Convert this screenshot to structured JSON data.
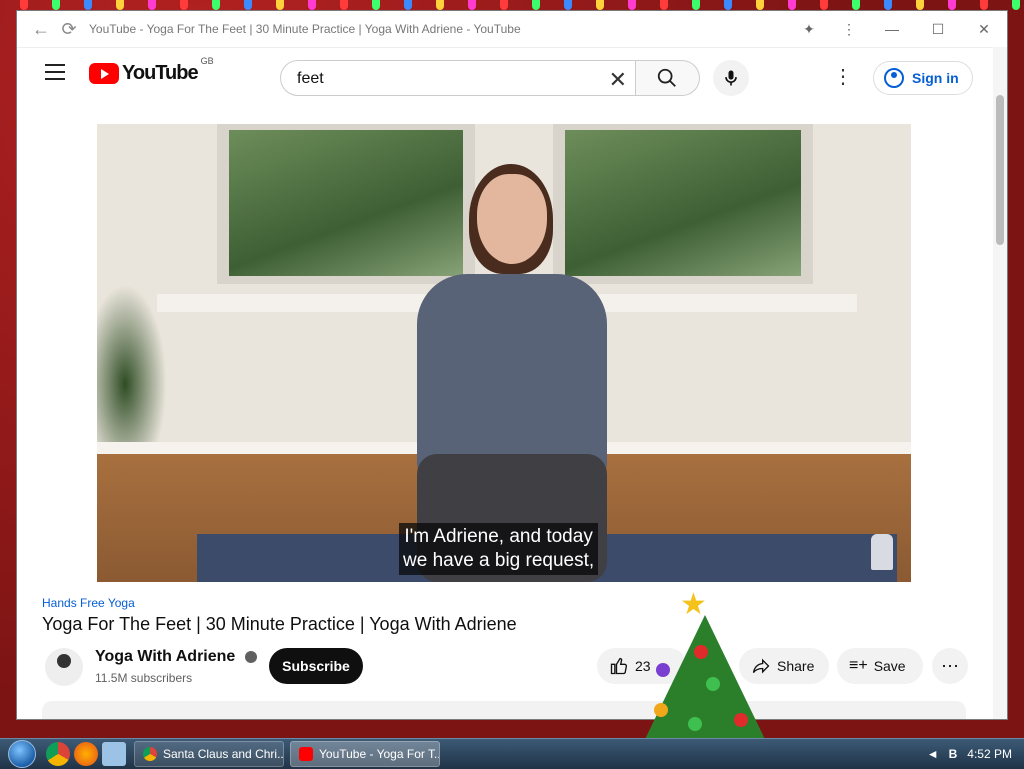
{
  "browser": {
    "tab_title": "YouTube - Yoga For The Feet | 30 Minute Practice | Yoga With Adriene - YouTube"
  },
  "youtube": {
    "logo_text": "YouTube",
    "region": "GB",
    "search": {
      "value": "feet"
    },
    "signin_label": "Sign in"
  },
  "video": {
    "caption_line1": "I'm Adriene, and today",
    "caption_line2": "we have a big request,",
    "tag": "Hands Free Yoga",
    "title": "Yoga For The Feet | 30 Minute Practice | Yoga With Adriene",
    "channel": "Yoga With Adriene",
    "subscribers": "11.5M subscribers",
    "subscribe_label": "Subscribe",
    "likes": "23",
    "share_label": "Share",
    "save_label": "Save"
  },
  "taskbar": {
    "tasks": [
      {
        "label": "Santa Claus and Chri..."
      },
      {
        "label": "YouTube - Yoga For T..."
      }
    ],
    "clock": "4:52 PM"
  },
  "colors": {
    "accent": "#065fd4",
    "youtube_red": "#ff0000",
    "desktop": "#8b1a1a"
  }
}
